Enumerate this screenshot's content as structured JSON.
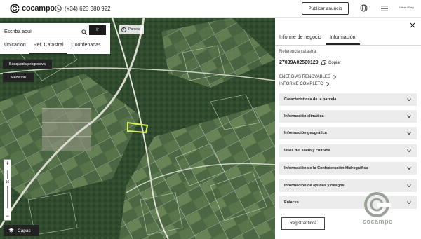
{
  "header": {
    "brand": "cocampo",
    "phone": "(+34) 623 380 922",
    "publish_label": "Publicar anuncio",
    "user_label": "Entrar / Reg"
  },
  "search": {
    "placeholder": "Escriba aquí",
    "value": "Escriba aquí",
    "go_label": "Ir",
    "tabs": [
      "Ubicación",
      "Ref. Catastral",
      "Coordenadas"
    ],
    "active_tab": "Ref. Catastral"
  },
  "map": {
    "progressive_search_label": "Búsqueda progresiva",
    "measure_label": "Medición",
    "chip_label": "Parcela",
    "zoom_level": "16",
    "zoom_in": "+",
    "zoom_out": "−",
    "layers_label": "Capas"
  },
  "panel": {
    "tabs": [
      "Informe de negocio",
      "Información"
    ],
    "active_tab": "Información",
    "ref_label": "Referencia catastral",
    "ref_value": "27039A02500129",
    "copy_label": "Copiar",
    "links": [
      "ENERGÍAS RENOVABLES",
      "INFORME COMPLETO"
    ],
    "sections": [
      "Características de la parcela",
      "Información climática",
      "Información geográfica",
      "Usos del suelo y cultivos",
      "Información de la Confederación Hidrográfica",
      "Información de ayudas y riesgos",
      "Enlaces"
    ],
    "register_label": "Registrar finca",
    "watermark": "cocampo"
  },
  "colors": {
    "accent": "#222222",
    "accordion_bg": "#ececec",
    "map_base": "#3f5a3a",
    "parcel_highlight": "#d8f25a",
    "watermark": "#9aa29a"
  }
}
